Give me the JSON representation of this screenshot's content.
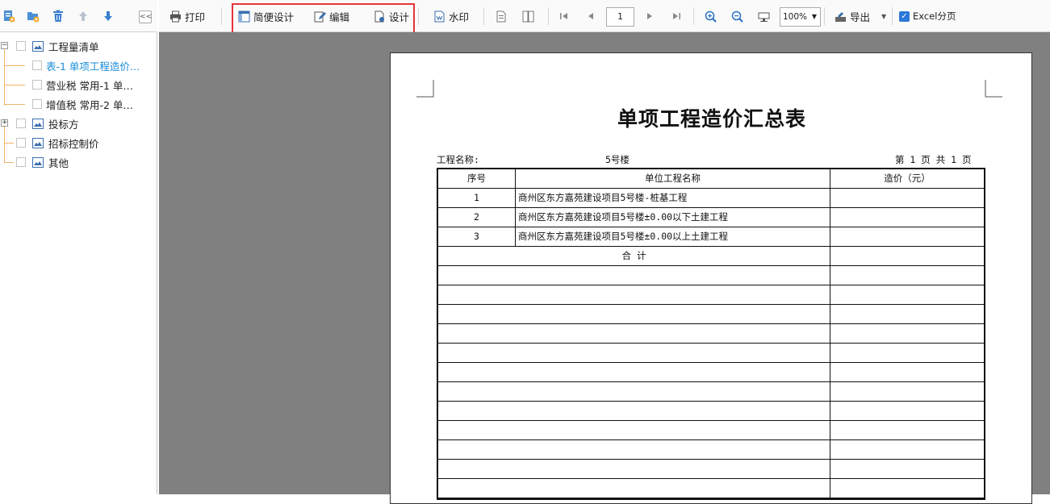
{
  "left_toolbar": {
    "collapse_label": "<<"
  },
  "tree": {
    "root1": "工程量清单",
    "child1": "表-1 单项工程造价…",
    "child2": "营业税 常用-1 单…",
    "child3": "增值税 常用-2 单…",
    "root2": "投标方",
    "root3": "招标控制价",
    "root4": "其他"
  },
  "toolbar": {
    "print": "打印",
    "simple_design": "简便设计",
    "edit": "编辑",
    "design": "设计",
    "watermark": "水印",
    "page": "1",
    "zoom": "100%",
    "export": "导出",
    "excel_pages": "Excel分页"
  },
  "colors": {
    "accent": "#1a8cd8",
    "highlight_border": "#e8333a",
    "preview_bg": "#808080"
  },
  "document": {
    "title": "单项工程造价汇总表",
    "project_label": "工程名称:",
    "project_name": "5号楼",
    "page_info": "第 1 页  共 1 页",
    "headers": [
      "序号",
      "单位工程名称",
      "造价（元）"
    ],
    "rows": [
      {
        "no": "1",
        "name": "商州区东方嘉苑建设项目5号楼-桩基工程",
        "cost": ""
      },
      {
        "no": "2",
        "name": "商州区东方嘉苑建设项目5号楼±0.00以下土建工程",
        "cost": ""
      },
      {
        "no": "3",
        "name": "商州区东方嘉苑建设项目5号楼±0.00以上土建工程",
        "cost": ""
      }
    ],
    "total_label": "合    计"
  }
}
